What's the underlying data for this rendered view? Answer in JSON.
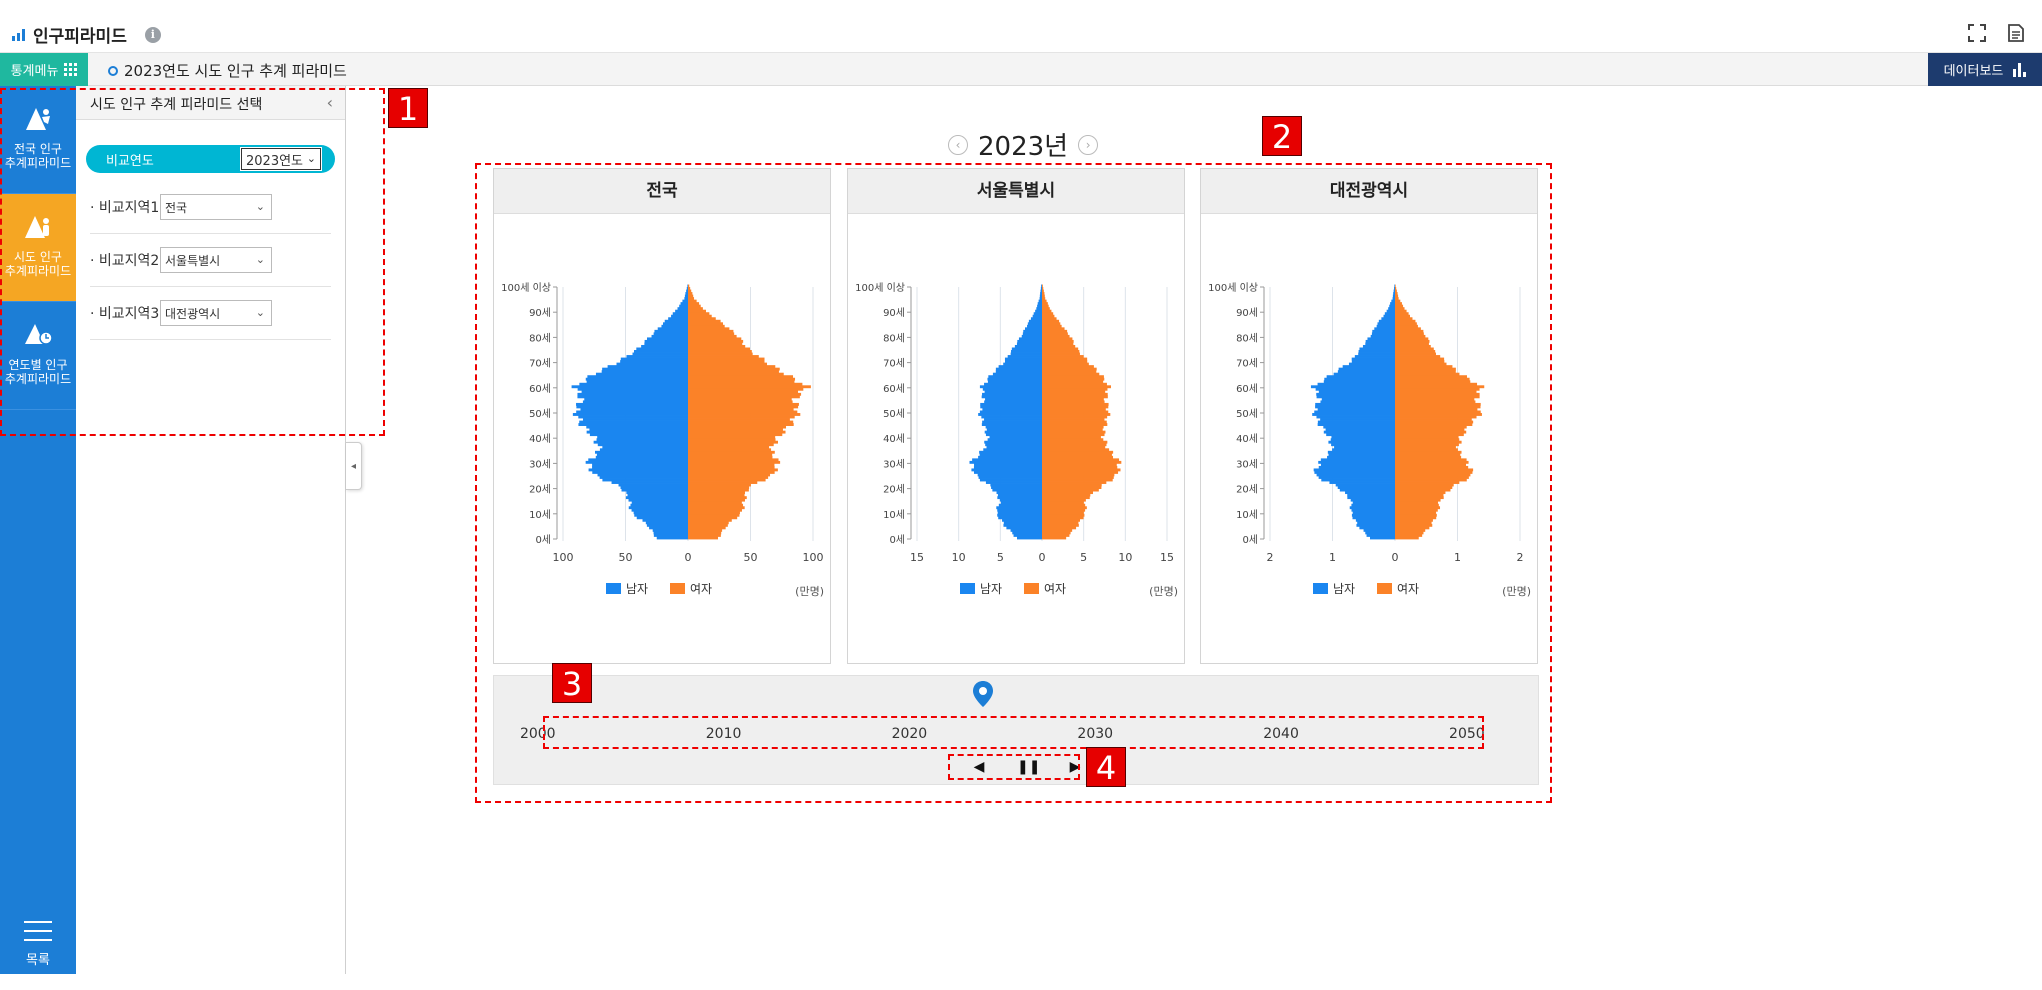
{
  "header": {
    "app_title": "인구피라미드",
    "info_glyph": "i"
  },
  "subbar": {
    "stat_menu_label": "통계메뉴",
    "page_title": "2023연도 시도 인구 추계 피라미드",
    "dashboard_label": "데이터보드"
  },
  "rail": {
    "items": [
      {
        "label_line1": "전국 인구",
        "label_line2": "추계피라미드"
      },
      {
        "label_line1": "시도 인구",
        "label_line2": "추계피라미드"
      },
      {
        "label_line1": "연도별 인구",
        "label_line2": "추계피라미드"
      }
    ],
    "list_label": "목록",
    "colors": {
      "rail": "#1c7ed6",
      "active": "#f5a623"
    }
  },
  "panel": {
    "title": "시도 인구 추계 피라미드 선택",
    "collapse_glyph": "‹",
    "compare_year_label": "비교연도",
    "compare_year_value": "2023연도",
    "regions": [
      {
        "label": "· 비교지역1",
        "value": "전국"
      },
      {
        "label": "· 비교지역2",
        "value": "서울특별시"
      },
      {
        "label": "· 비교지역3",
        "value": "대전광역시"
      }
    ],
    "toggle_glyph": "◂"
  },
  "year_nav": {
    "prev": "‹",
    "year": "2023년",
    "next": "›"
  },
  "legend": {
    "male": "남자",
    "female": "여자",
    "unit": "(만명)"
  },
  "colors": {
    "male": "#1a86f0",
    "female": "#fb8228"
  },
  "age_ticks": [
    "0세",
    "10세",
    "20세",
    "30세",
    "40세",
    "50세",
    "60세",
    "70세",
    "80세",
    "90세",
    "100세 이상"
  ],
  "chart_data": [
    {
      "type": "bar",
      "title": "전국",
      "x_ticks": [
        "100",
        "50",
        "0",
        "50",
        "100"
      ],
      "xlim": [
        -100,
        100
      ],
      "age_points": [
        0,
        5,
        10,
        15,
        20,
        25,
        30,
        35,
        40,
        45,
        50,
        55,
        60,
        65,
        70,
        75,
        80,
        85,
        90,
        95,
        100
      ],
      "male": [
        25,
        32,
        45,
        47,
        53,
        75,
        80,
        70,
        75,
        85,
        90,
        85,
        90,
        75,
        55,
        40,
        30,
        20,
        10,
        3,
        0.5
      ],
      "female": [
        24,
        31,
        43,
        45,
        48,
        68,
        72,
        66,
        72,
        82,
        88,
        85,
        95,
        78,
        62,
        48,
        40,
        28,
        14,
        5,
        1
      ]
    },
    {
      "type": "bar",
      "title": "서울특별시",
      "x_ticks": [
        "15",
        "10",
        "5",
        "0",
        "5",
        "10",
        "15"
      ],
      "xlim": [
        -15,
        15
      ],
      "age_points": [
        0,
        5,
        10,
        15,
        20,
        25,
        30,
        35,
        40,
        45,
        50,
        55,
        60,
        65,
        70,
        75,
        80,
        85,
        90,
        95,
        100
      ],
      "male": [
        3,
        4.5,
        5.5,
        5,
        6,
        8,
        8.5,
        7,
        6.5,
        7,
        7.5,
        7,
        7.2,
        6,
        4.5,
        3.5,
        2.5,
        1.7,
        0.8,
        0.3,
        0.1
      ],
      "female": [
        2.9,
        4.3,
        5.2,
        5.2,
        7,
        9,
        9.3,
        8,
        7.3,
        7.6,
        8,
        7.6,
        8,
        7,
        5.5,
        4.2,
        3.4,
        2.2,
        1.1,
        0.4,
        0.1
      ]
    },
    {
      "type": "bar",
      "title": "대전광역시",
      "x_ticks": [
        "2",
        "1",
        "0",
        "1",
        "2"
      ],
      "xlim": [
        -2,
        2
      ],
      "age_points": [
        0,
        5,
        10,
        15,
        20,
        25,
        30,
        35,
        40,
        45,
        50,
        55,
        60,
        65,
        70,
        75,
        80,
        85,
        90,
        95,
        100
      ],
      "male": [
        0.4,
        0.6,
        0.7,
        0.7,
        0.9,
        1.3,
        1.2,
        1.0,
        1.05,
        1.2,
        1.3,
        1.2,
        1.3,
        1.0,
        0.7,
        0.55,
        0.4,
        0.28,
        0.13,
        0.04,
        0.01
      ],
      "female": [
        0.38,
        0.58,
        0.68,
        0.72,
        0.9,
        1.25,
        1.15,
        1.0,
        1.05,
        1.2,
        1.38,
        1.3,
        1.38,
        1.05,
        0.8,
        0.6,
        0.5,
        0.35,
        0.18,
        0.06,
        0.01
      ]
    }
  ],
  "timeline": {
    "ticks": [
      "2000",
      "2010",
      "2020",
      "2030",
      "2040",
      "2050"
    ],
    "current_year": 2023,
    "controls": {
      "prev": "◀",
      "pause": "⏸",
      "next": "▶"
    }
  },
  "annotations": [
    "1",
    "2",
    "3",
    "4"
  ]
}
